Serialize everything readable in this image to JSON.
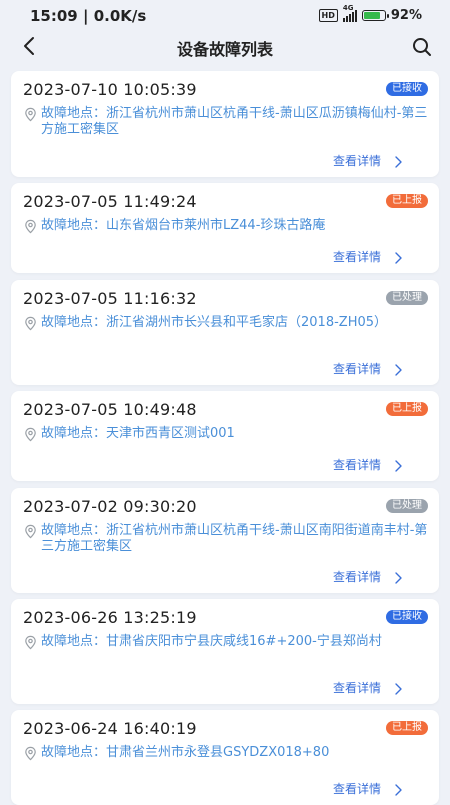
{
  "status_bar": {
    "time": "15:09",
    "speed": "0.0K/s",
    "hd": "HD",
    "network": "4G",
    "battery": "92%",
    "battery_level": 0.92
  },
  "header": {
    "title": "设备故障列表"
  },
  "colors": {
    "received": "#2f6ce3",
    "reported": "#f26c3a",
    "processed": "#9aa3ad",
    "location": "#4a8fd8",
    "link": "#3a6fd8"
  },
  "location_prefix": "故障地点：",
  "detail_label": "查看详情",
  "records": [
    {
      "time": "2023-07-10 10:05:39",
      "status": "已接收",
      "status_type": "received",
      "location": "浙江省杭州市萧山区杭甬干线-萧山区瓜沥镇梅仙村-第三方施工密集区"
    },
    {
      "time": "2023-07-05 11:49:24",
      "status": "已上报",
      "status_type": "reported",
      "location": "山东省烟台市莱州市LZ44-珍珠古路庵"
    },
    {
      "time": "2023-07-05 11:16:32",
      "status": "已处理",
      "status_type": "processed",
      "location": "浙江省湖州市长兴县和平毛家店（2018-ZH05）"
    },
    {
      "time": "2023-07-05 10:49:48",
      "status": "已上报",
      "status_type": "reported",
      "location": "天津市西青区测试001"
    },
    {
      "time": "2023-07-02 09:30:20",
      "status": "已处理",
      "status_type": "processed",
      "location": "浙江省杭州市萧山区杭甬干线-萧山区南阳街道南丰村-第三方施工密集区"
    },
    {
      "time": "2023-06-26 13:25:19",
      "status": "已接收",
      "status_type": "received",
      "location": "甘肃省庆阳市宁县庆咸线16#+200-宁县郑尚村"
    },
    {
      "time": "2023-06-24 16:40:19",
      "status": "已上报",
      "status_type": "reported",
      "location": "甘肃省兰州市永登县GSYDZX018+80"
    }
  ]
}
